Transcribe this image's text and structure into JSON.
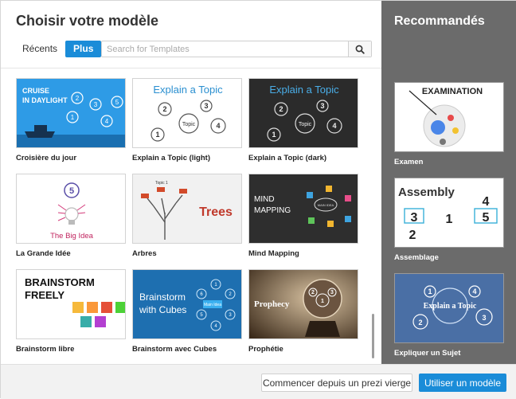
{
  "dialog": {
    "title": "Choisir votre modèle",
    "tabs": [
      {
        "label": "Récents",
        "active": false
      },
      {
        "label": "Plus",
        "active": true
      }
    ],
    "search": {
      "placeholder": "Search for Templates"
    }
  },
  "templates": [
    {
      "label": "Croisière du jour",
      "thumb_text": [
        "CRUISE",
        "IN DAYLIGHT"
      ],
      "numbers": [
        "1",
        "2",
        "3",
        "4",
        "5"
      ]
    },
    {
      "label": "Explain a Topic (light)",
      "thumb_text": [
        "Explain a Topic",
        "Topic"
      ],
      "numbers": [
        "1",
        "2",
        "3",
        "4"
      ]
    },
    {
      "label": "Explain a Topic (dark)",
      "thumb_text": [
        "Explain a Topic",
        "Topic"
      ],
      "numbers": [
        "1",
        "2",
        "3",
        "4"
      ]
    },
    {
      "label": "La Grande Idée",
      "thumb_text": [
        "The Big Idea"
      ],
      "numbers": [
        "5"
      ]
    },
    {
      "label": "Arbres",
      "thumb_text": [
        "Trees",
        "Topic 1"
      ]
    },
    {
      "label": "Mind Mapping",
      "thumb_text": [
        "MIND",
        "MAPPING",
        "MAIN IDEA"
      ]
    },
    {
      "label": "Brainstorm libre",
      "thumb_text": [
        "BRAINSTORM",
        "FREELY"
      ]
    },
    {
      "label": "Brainstorm avec Cubes",
      "thumb_text": [
        "Brainstorm",
        "with Cubes",
        "Main Idea"
      ],
      "numbers": [
        "1",
        "2",
        "3",
        "4",
        "5",
        "6"
      ]
    },
    {
      "label": "Prophétie",
      "thumb_text": [
        "Prophecy"
      ],
      "numbers": [
        "1",
        "2",
        "3"
      ]
    }
  ],
  "recommended": {
    "title": "Recommandés",
    "items": [
      {
        "label": "Examen",
        "thumb_text": [
          "EXAMINATION"
        ]
      },
      {
        "label": "Assemblage",
        "thumb_text": [
          "Assembly"
        ],
        "numbers": [
          "1",
          "2",
          "3",
          "4",
          "5"
        ]
      },
      {
        "label": "Expliquer un Sujet",
        "thumb_text": [
          "Explain a Topic"
        ],
        "numbers": [
          "1",
          "2",
          "3",
          "4"
        ]
      }
    ]
  },
  "footer": {
    "blank_label": "Commencer depuis un prezi vierge",
    "use_label": "Utiliser un modèle"
  },
  "colors": {
    "accent": "#1a8cd8",
    "sidebar": "#6b6b6b"
  },
  "icons": {
    "search": "magnifier-icon"
  }
}
